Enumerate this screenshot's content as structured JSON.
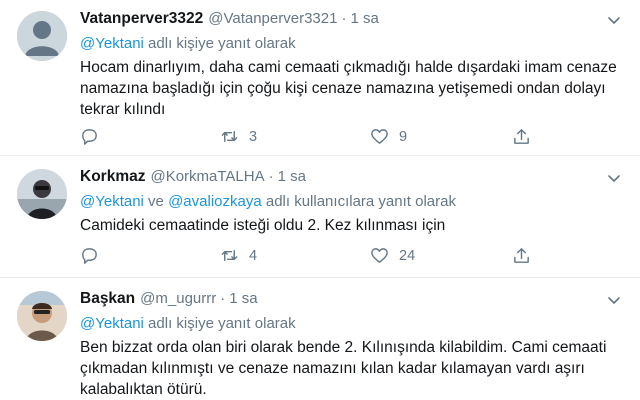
{
  "tweets": [
    {
      "name": "Vatanperver3322",
      "handle": "@Vatanperver3321",
      "dot": "·",
      "time": "1 sa",
      "reply_mentions": [
        "@Yektani"
      ],
      "reply_joiner": "",
      "reply_suffix": " adlı kişiye yanıt olarak",
      "text": "Hocam dinarlıyım, daha cami cemaati çıkmadığı halde dışardaki imam cenaze namazına başladığı için çoğu kişi cenaze namazına yetişemedi ondan dolayı tekrar kılındı",
      "retweets": "3",
      "likes": "9",
      "avatar": "default-avatar"
    },
    {
      "name": "Korkmaz",
      "handle": "@KorkmaTALHA",
      "dot": "·",
      "time": "1 sa",
      "reply_mentions": [
        "@Yektani",
        "@avaliozkaya"
      ],
      "reply_joiner": " ve ",
      "reply_suffix": " adlı kullanıcılara yanıt olarak",
      "text": "Camideki cemaatinde isteği oldu 2. Kez kılınması için",
      "retweets": "4",
      "likes": "24",
      "avatar": "photo-avatar"
    },
    {
      "name": "Başkan",
      "handle": "@m_ugurrr",
      "dot": "·",
      "time": "1 sa",
      "reply_mentions": [
        "@Yektani"
      ],
      "reply_joiner": "",
      "reply_suffix": " adlı kişiye yanıt olarak",
      "text": "Ben bizzat orda olan biri olarak bende 2. Kılınışında kilabildim. Cami cemaati çıkmadan kılınmıştı ve cenaze namazını kılan kadar kılamayan vardı aşırı kalabalıktan ötürü.",
      "retweets": "",
      "likes": "",
      "avatar": "photo-avatar"
    }
  ],
  "colors": {
    "link": "#1b95e0",
    "secondary": "#657786",
    "text": "#14171a",
    "divider": "#e6ecf0"
  },
  "icons": [
    "chevron-down-icon",
    "reply-icon",
    "retweet-icon",
    "like-icon",
    "share-icon"
  ]
}
